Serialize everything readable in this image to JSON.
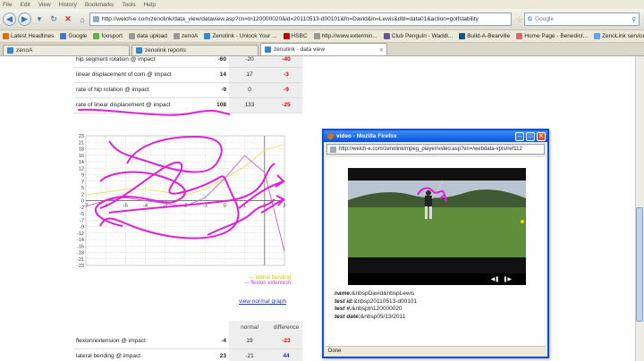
{
  "menu": [
    "File",
    "Edit",
    "View",
    "History",
    "Bookmarks",
    "Tools",
    "Help"
  ],
  "address": {
    "url": "http://welch-e.com/zenolink/data_view/dataview.asp?cn=tn120000020&id=20110513-d00101&fn=David&ln=Lewis&dbl=data01&action=golfstability"
  },
  "search": {
    "placeholder": "Google"
  },
  "bookmarks": [
    {
      "label": "Latest Headlines",
      "color": "#e36c0a"
    },
    {
      "label": "Google",
      "color": "#3c78d8"
    },
    {
      "label": "foosport",
      "color": "#6aa84f"
    },
    {
      "label": "data upload",
      "color": "#999999"
    },
    {
      "label": "zenoA",
      "color": "#999999"
    },
    {
      "label": "Zenolink - Unlock Your ...",
      "color": "#3d85c6"
    },
    {
      "label": "HSBC",
      "color": "#cc0000"
    },
    {
      "label": "http://www.extermin...",
      "color": "#999999"
    },
    {
      "label": "Club Penguin - Waddl...",
      "color": "#674ea7"
    },
    {
      "label": "Build-A-Bearville",
      "color": "#0b5394"
    },
    {
      "label": "Home Page - Benedict...",
      "color": "#e06666"
    },
    {
      "label": "ZenoLink service orde...",
      "color": "#6d9eeb"
    }
  ],
  "tabs": [
    {
      "label": "zenoA",
      "active": false
    },
    {
      "label": "zenolink reports",
      "active": false
    },
    {
      "label": "zenolink - data view",
      "active": true
    }
  ],
  "top_table": [
    {
      "label": "hip segment rotation @ impact",
      "value": "-60",
      "normal": "-20",
      "diff": "-40",
      "sign": "neg"
    },
    {
      "label": "linear displacement of com @ impact",
      "value": "14",
      "normal": "17",
      "diff": "-3",
      "sign": "neg"
    },
    {
      "label": "rate of hip rotation @ impact",
      "value": "-9",
      "normal": "0",
      "diff": "-9",
      "sign": "neg"
    },
    {
      "label": "rate of linear displacement @ impact",
      "value": "108",
      "normal": "133",
      "diff": "-25",
      "sign": "neg"
    }
  ],
  "chart_data": {
    "type": "line",
    "title": "",
    "xlabel": "",
    "ylabel": "",
    "y_ticks": [
      "23",
      "21",
      "18",
      "16",
      "14",
      "12",
      "9",
      "7",
      "5",
      "2",
      "0",
      "-2",
      "-5",
      "-7",
      "-9",
      "-12",
      "-14",
      "-16",
      "-18",
      "-21",
      "-23"
    ],
    "x_ticks": [
      "-7",
      "-6",
      "-5",
      "-4",
      "-3",
      "-2",
      "-1",
      "0",
      "1",
      "2",
      "3"
    ],
    "ylim": [
      -23,
      23
    ],
    "xlim": [
      -7,
      3
    ],
    "grid": true,
    "legend_position": "bottom-right",
    "series": [
      {
        "name": "lateral bending",
        "color": "#e8e05a",
        "x": [
          -7,
          -6,
          -5,
          -4,
          -3,
          -2,
          -1,
          0,
          1,
          2,
          3
        ],
        "y": [
          2,
          3,
          4,
          4,
          3,
          2,
          4,
          8,
          12,
          18,
          20
        ]
      },
      {
        "name": "flexion extension",
        "color": "#c060c0",
        "x": [
          -7,
          -6,
          -5,
          -4,
          -3,
          -2,
          -1,
          0,
          1,
          2,
          3
        ],
        "y": [
          -2,
          0,
          1,
          0,
          -1,
          -2,
          1,
          8,
          16,
          10,
          -18
        ]
      }
    ],
    "legend": [
      {
        "label": "--- lateral bending",
        "color": "#d8c400"
      },
      {
        "label": "--- flexion extension",
        "color": "#c040c0"
      }
    ],
    "link": "view normal graph"
  },
  "bottom_table": {
    "headers": [
      "",
      "",
      "normal",
      "difference"
    ],
    "rows": [
      {
        "label": "flexion/extension @ impact",
        "value": "-4",
        "normal": "19",
        "diff": "-23",
        "sign": "neg"
      },
      {
        "label": "lateral bending @ impact",
        "value": "23",
        "normal": "-21",
        "diff": "44",
        "sign": "pos"
      }
    ]
  },
  "popup": {
    "title": "video - Mozilla Firefox",
    "url": "http://welch-e.com/zenolink/mpeg_player/video.asp?vn=/webdata-vpts/ref112",
    "status": "Done",
    "info": [
      {
        "key": "name:",
        "value": "&nbspDavid&nbspLewis"
      },
      {
        "key": "test id:",
        "value": "&nbsp20110513-d00101"
      },
      {
        "key": "test #:",
        "value": "&nbsptn120000020"
      },
      {
        "key": "test date:",
        "value": "&nbsp05/13/2011"
      }
    ]
  }
}
